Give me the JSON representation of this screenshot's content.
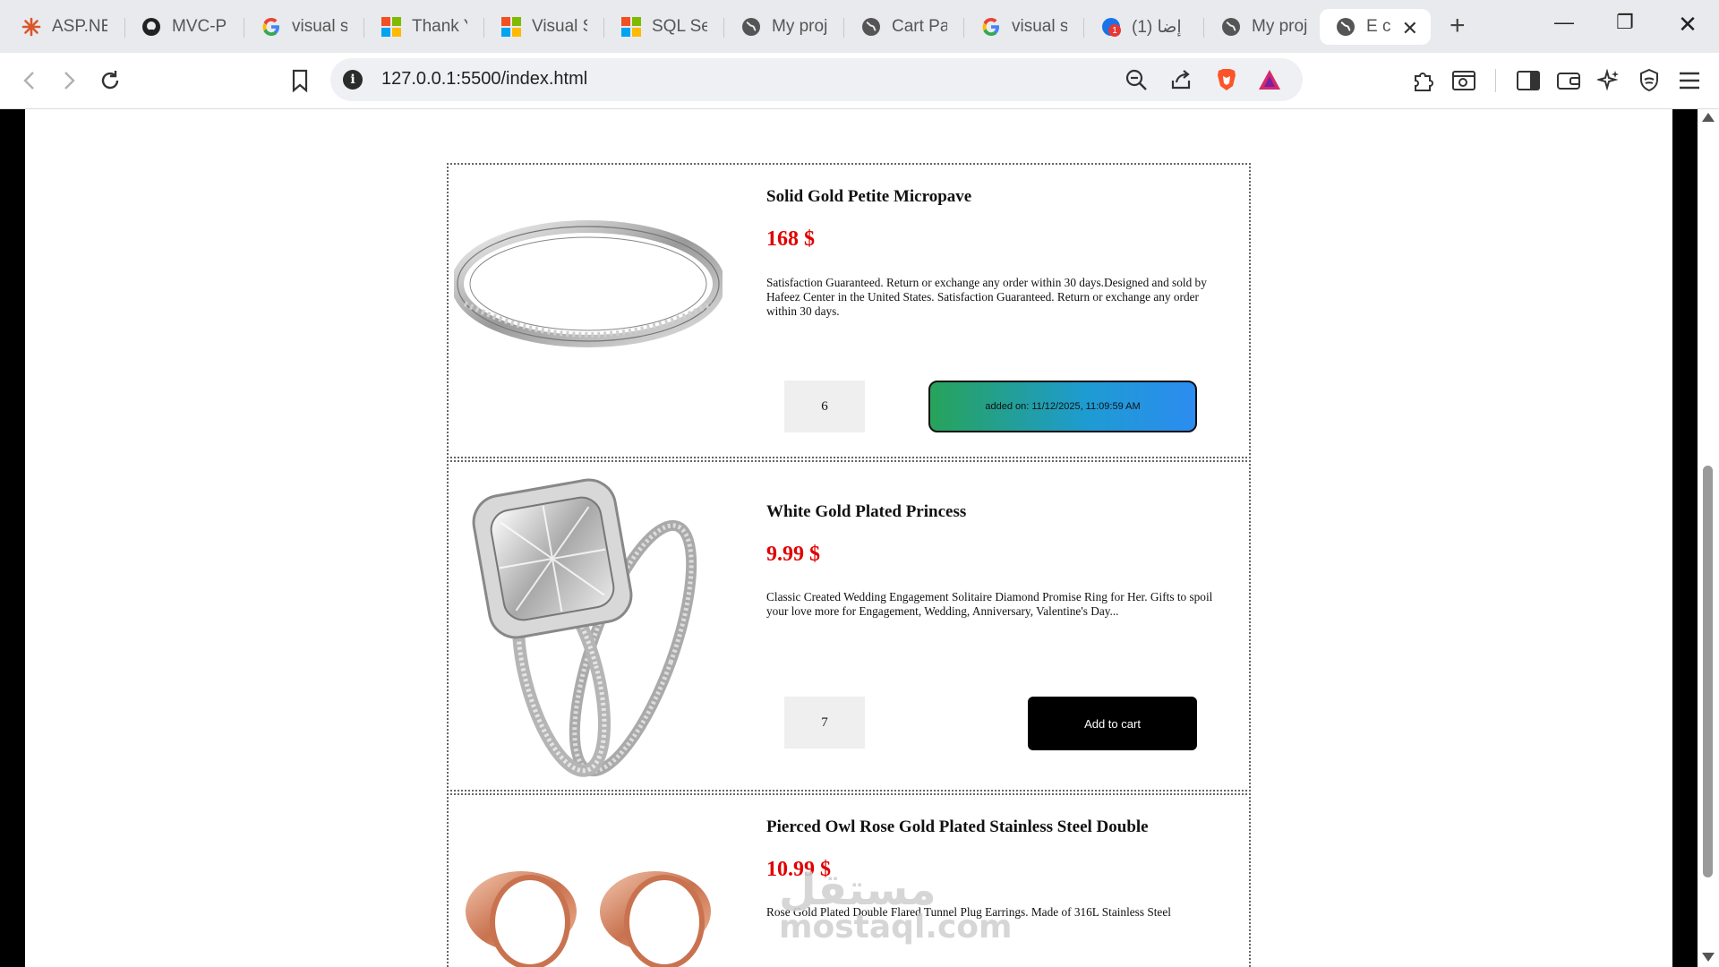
{
  "browser": {
    "tabs": [
      {
        "title": "ASP.NE",
        "icon": "asterisk-icon"
      },
      {
        "title": "MVC-Pr",
        "icon": "github-icon"
      },
      {
        "title": "visual st",
        "icon": "google-icon"
      },
      {
        "title": "Thank Y",
        "icon": "microsoft-icon"
      },
      {
        "title": "Visual S",
        "icon": "microsoft-icon"
      },
      {
        "title": "SQL Ser",
        "icon": "microsoft-icon"
      },
      {
        "title": "My proj",
        "icon": "globe-icon"
      },
      {
        "title": "Cart Pa",
        "icon": "globe-icon"
      },
      {
        "title": "visual st",
        "icon": "google-icon"
      },
      {
        "title": "(1) إضا",
        "icon": "notification-icon"
      },
      {
        "title": "My proj",
        "icon": "globe-icon"
      },
      {
        "title": "E c",
        "icon": "globe-icon",
        "active": true
      }
    ],
    "url": "127.0.0.1:5500/index.html",
    "notification_badge": "1"
  },
  "products": [
    {
      "name": "Solid Gold Petite Micropave",
      "price": "168 $",
      "description": "Satisfaction Guaranteed. Return or exchange any order within 30 days.Designed and sold by Hafeez Center in the United States. Satisfaction Guaranteed. Return or exchange any order within 30 days.",
      "quantity": "6",
      "button_label": "added on: 11/12/2025, 11:09:59 AM",
      "state": "added"
    },
    {
      "name": "White Gold Plated Princess",
      "price": "9.99 $",
      "description": "Classic Created Wedding Engagement Solitaire Diamond Promise Ring for Her. Gifts to spoil your love more for Engagement, Wedding, Anniversary, Valentine's Day...",
      "quantity": "7",
      "button_label": "Add to cart",
      "state": "default"
    },
    {
      "name": "Pierced Owl Rose Gold Plated Stainless Steel Double",
      "price": "10.99 $",
      "description": "Rose Gold Plated Double Flared Tunnel Plug Earrings. Made of 316L Stainless Steel"
    }
  ],
  "watermark": {
    "arabic": "مستقل",
    "latin": "mostaql.com"
  },
  "colors": {
    "price": "#e00000",
    "added_gradient_start": "#27a35a",
    "added_gradient_end": "#2c8cf0",
    "add_button": "#000000"
  }
}
